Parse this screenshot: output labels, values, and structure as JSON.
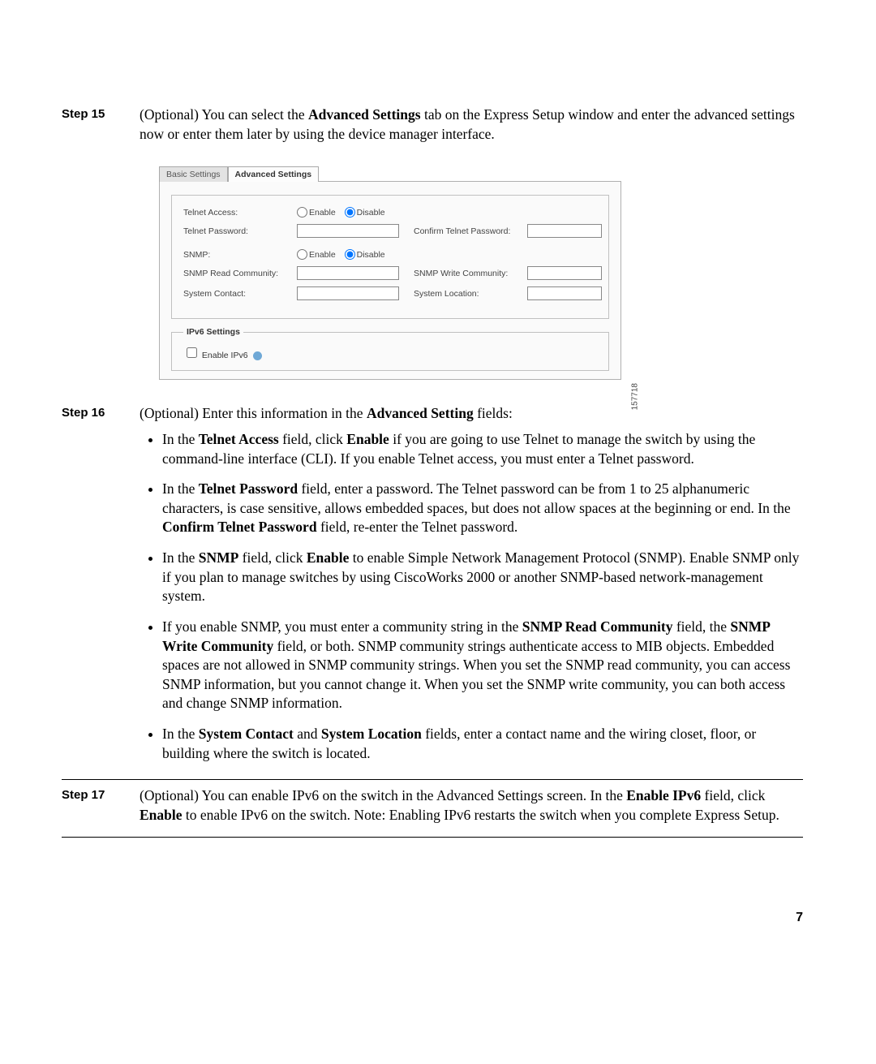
{
  "page_number": "7",
  "figure_id": "157718",
  "steps": [
    {
      "label": "Step 15",
      "intro_before_bold": "(Optional) You can select the ",
      "intro_bold": "Advanced Settings",
      "intro_after_bold": " tab on the Express Setup window and enter the advanced settings now or enter them later by using the device manager interface."
    },
    {
      "label": "Step 16",
      "intro_before_bold": "(Optional) Enter this information in the ",
      "intro_bold": "Advanced Setting",
      "intro_after_bold": " fields:"
    },
    {
      "label": "Step 17",
      "intro_part1": "(Optional) You can enable IPv6 on the switch in the Advanced Settings screen. In the ",
      "intro_bold1": "Enable IPv6",
      "intro_part2": " field, click ",
      "intro_bold2": "Enable",
      "intro_part3": " to enable IPv6 on the switch. Note: Enabling IPv6 restarts the switch when you complete Express Setup."
    }
  ],
  "bullets": [
    {
      "p1": "In the ",
      "b1": "Telnet Access",
      "p2": " field, click ",
      "b2": "Enable",
      "p3": " if you are going to use Telnet to manage the switch by using the command-line interface (CLI). If you enable Telnet access, you must enter a Telnet password."
    },
    {
      "p1": "In the ",
      "b1": "Telnet Password",
      "p2": " field, enter a password. The Telnet password can be from 1 to 25 alphanumeric characters, is case sensitive, allows embedded spaces, but does not allow spaces at the beginning or end. In the ",
      "b2": "Confirm Telnet Password",
      "p3": " field, re-enter the Telnet password."
    },
    {
      "p1": "In the ",
      "b1": "SNMP",
      "p2": " field, click ",
      "b2": "Enable",
      "p3": " to enable Simple Network Management Protocol (SNMP). Enable SNMP only if you plan to manage switches by using CiscoWorks 2000 or another SNMP-based network-management system."
    },
    {
      "p1": "If you enable SNMP, you must enter a community string in the ",
      "b1": "SNMP Read Community",
      "p2": " field, the ",
      "b2": "SNMP Write Community",
      "p3": " field, or both. SNMP community strings authenticate access to MIB objects. Embedded spaces are not allowed in SNMP community strings. When you set the SNMP read community, you can access SNMP information, but you cannot change it. When you set the SNMP write community, you can both access and change SNMP information."
    },
    {
      "p1": "In the ",
      "b1": "System Contact",
      "p2": " and ",
      "b2": "System Location",
      "p3": " fields, enter a contact name and the wiring closet, floor, or building where the switch is located."
    }
  ],
  "ui": {
    "tabs": {
      "basic": "Basic Settings",
      "advanced": "Advanced Settings"
    },
    "telnet_access_label": "Telnet Access:",
    "telnet_password_label": "Telnet Password:",
    "confirm_telnet_password_label": "Confirm Telnet Password:",
    "snmp_label": "SNMP:",
    "snmp_read_label": "SNMP Read Community:",
    "snmp_write_label": "SNMP Write Community:",
    "system_contact_label": "System Contact:",
    "system_location_label": "System Location:",
    "enable_label": "Enable",
    "disable_label": "Disable",
    "ipv6_legend": "IPv6 Settings",
    "enable_ipv6_label": "Enable IPv6"
  }
}
